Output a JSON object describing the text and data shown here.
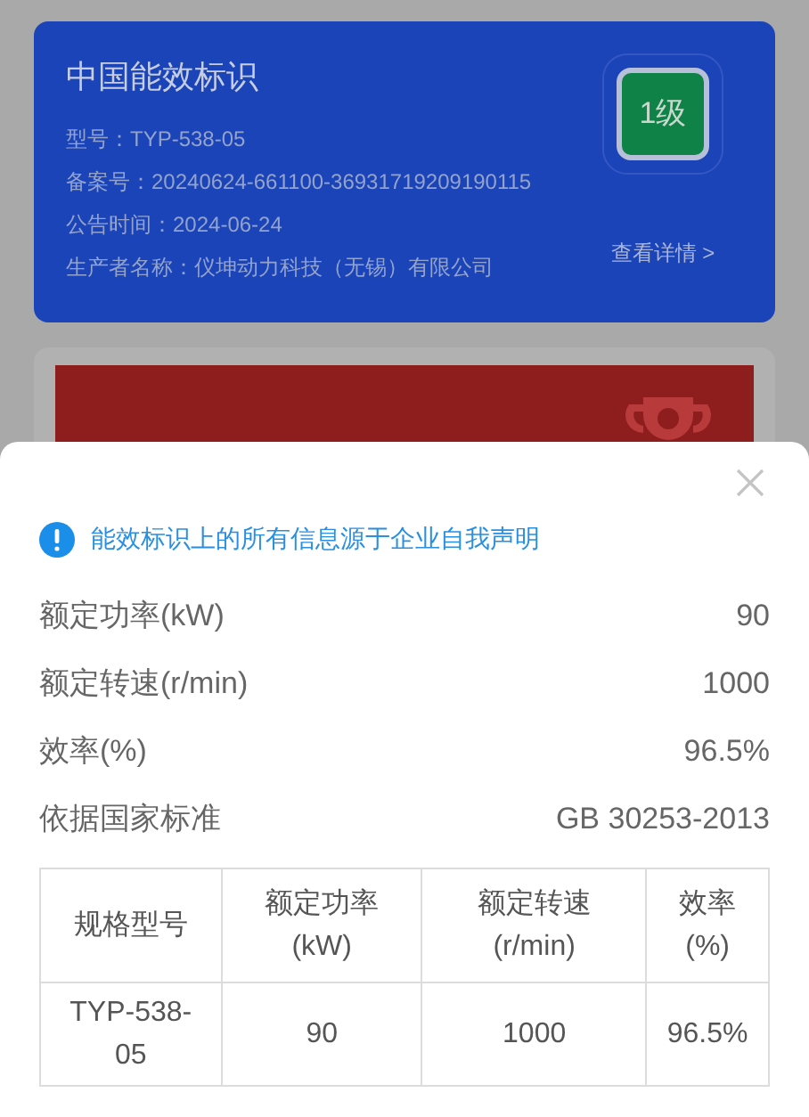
{
  "label_card": {
    "title": "中国能效标识",
    "lines": [
      "型号：TYP-538-05",
      "备案号：20240624-661100-36931719209190115",
      "公告时间：2024-06-24",
      "生产者名称：仪坤动力科技（无锡）有限公司"
    ],
    "grade": "1级",
    "details_link": "查看详情 >"
  },
  "sheet": {
    "notice": "能效标识上的所有信息源于企业自我声明",
    "specs": [
      {
        "label": "额定功率(kW)",
        "value": "90"
      },
      {
        "label": "额定转速(r/min)",
        "value": "1000"
      },
      {
        "label": "效率(%)",
        "value": "96.5%"
      },
      {
        "label": "依据国家标准",
        "value": "GB 30253-2013"
      }
    ],
    "table": {
      "columns": [
        "规格型号",
        "额定功率\n(kW)",
        "额定转速\n(r/min)",
        "效率\n(%)"
      ],
      "rows": [
        [
          "TYP-538-\n05",
          "90",
          "1000",
          "96.5%"
        ]
      ]
    }
  }
}
